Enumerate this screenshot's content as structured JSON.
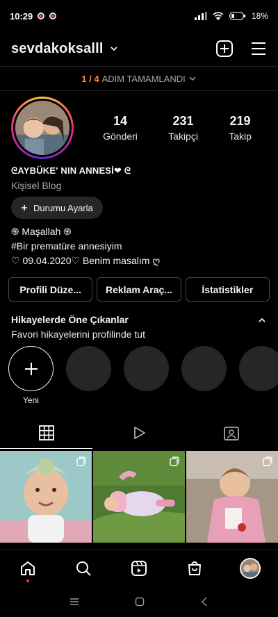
{
  "status_bar": {
    "time": "10:29",
    "battery": "18%"
  },
  "header": {
    "username": "sevdakoksalll"
  },
  "steps": {
    "progress": "1 / 4",
    "label": "ADIM TAMAMLANDI"
  },
  "stats": [
    {
      "num": "14",
      "label": "Gönderi"
    },
    {
      "num": "231",
      "label": "Takipçi"
    },
    {
      "num": "219",
      "label": "Takip"
    }
  ],
  "bio": {
    "name": "ᘓAYBÜKE' NIN ANNESİ❤ ᘓ",
    "category": "Kişisel Blog",
    "status_button": "Durumu Ayarla",
    "lines": [
      "֍ Maşallah ֍",
      "#Bir prematüre annesiyim",
      "♡ 09.04.2020♡  Benim masalım ღ"
    ]
  },
  "buttons": {
    "edit_profile": "Profili Düze...",
    "ad_tools": "Reklam Araç...",
    "insights": "İstatistikler"
  },
  "highlights": {
    "title": "Hikayelerde Öne Çıkanlar",
    "subtitle": "Favori hikayelerini profilinde tut",
    "new_label": "Yeni"
  },
  "colors": {
    "accent_orange": "#ff8a3d",
    "notification_red": "#ff3040",
    "background": "#000000"
  }
}
